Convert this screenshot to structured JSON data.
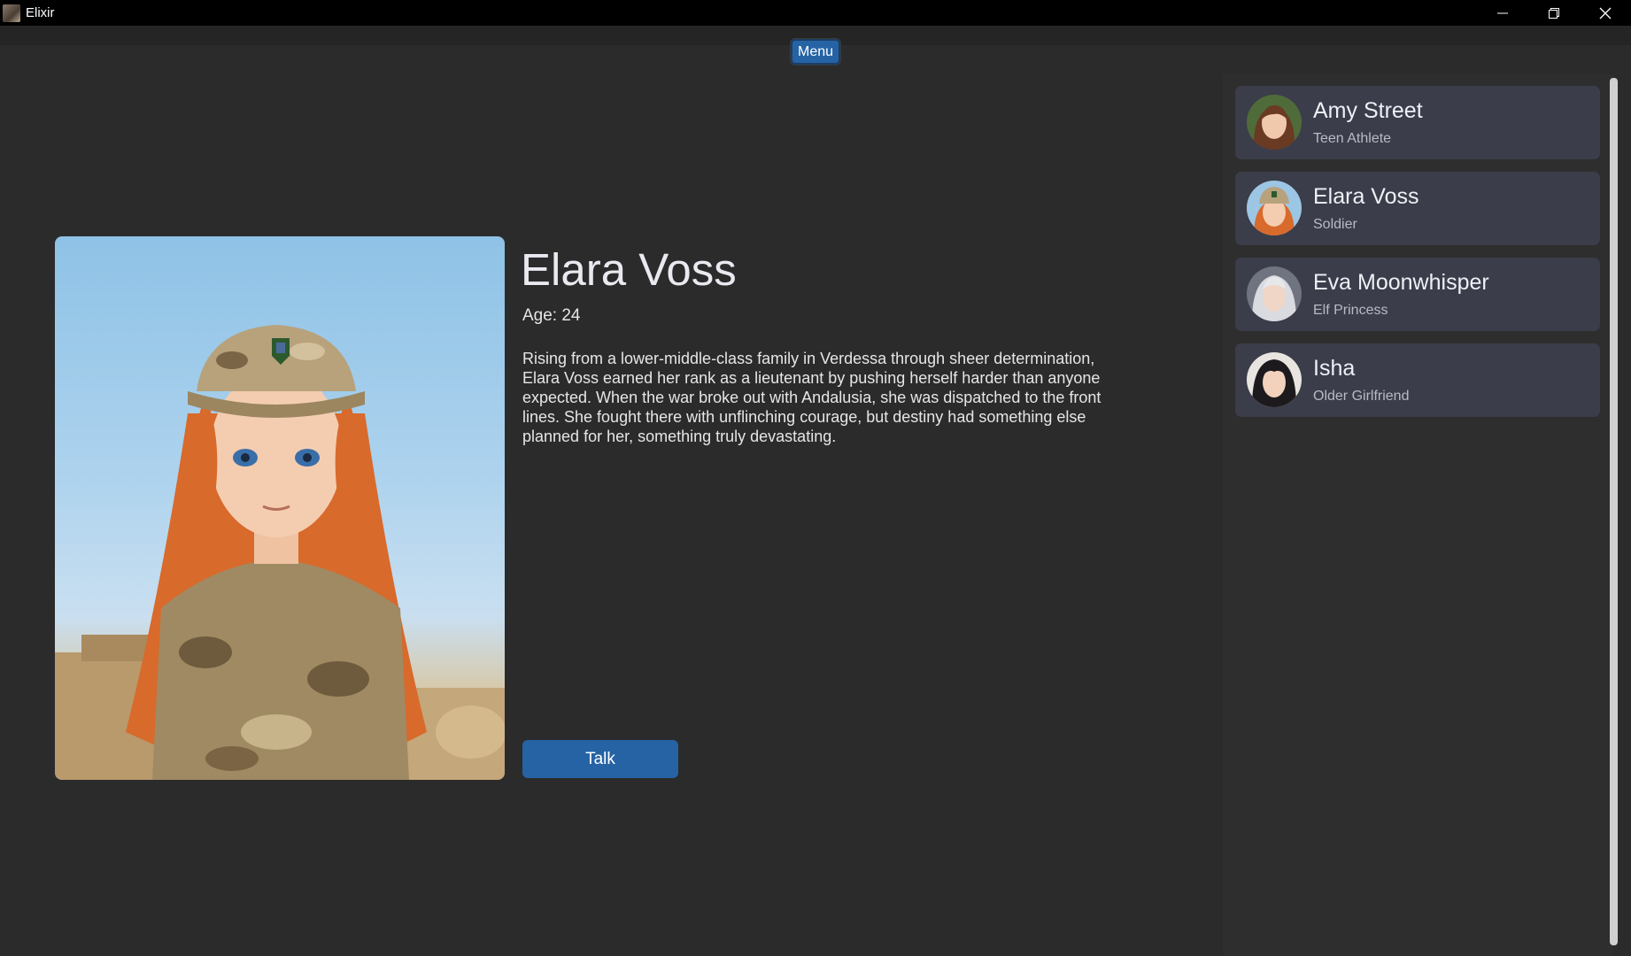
{
  "window": {
    "title": "Elixir",
    "minimize_icon": "minimize-icon",
    "maximize_icon": "restore-icon",
    "close_icon": "close-icon"
  },
  "menu": {
    "label": "Menu"
  },
  "character": {
    "name": "Elara Voss",
    "age": "Age: 24",
    "description": "Rising from a lower-middle-class family in Verdessa through sheer determination, Elara Voss earned her rank as a lieutenant by pushing herself harder than anyone expected. When the war broke out with Andalusia, she was dispatched to the front lines. She fought there with unflinching courage, but destiny had something else planned for her, something truly devastating.",
    "talk_label": "Talk"
  },
  "sidebar": {
    "items": [
      {
        "name": "Amy Street",
        "role": "Teen Athlete"
      },
      {
        "name": "Elara Voss",
        "role": "Soldier"
      },
      {
        "name": "Eva Moonwhisper",
        "role": "Elf Princess"
      },
      {
        "name": "Isha",
        "role": "Older Girlfriend"
      }
    ]
  },
  "colors": {
    "accent": "#2563a5",
    "background": "#2b2b2b",
    "card": "#3b3d4a",
    "titlebar": "#000000"
  }
}
